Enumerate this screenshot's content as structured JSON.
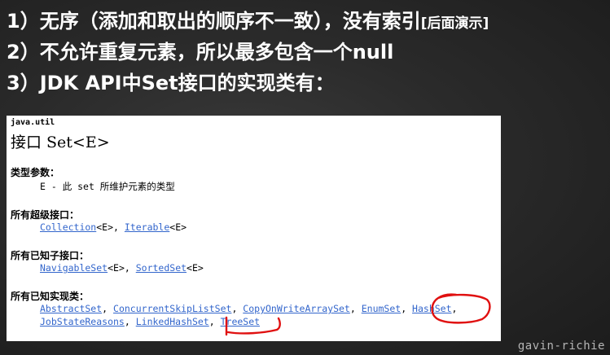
{
  "headings": {
    "l1_main": "1）无序（添加和取出的顺序不一致），没有索引",
    "l1_note": "[后面演示]",
    "l2": "2）不允许重复元素，所以最多包含一个null",
    "l3": "3）JDK API中Set接口的实现类有："
  },
  "doc": {
    "package": "java.util",
    "title": "接口 Set<E>",
    "type_params": {
      "label": "类型参数：",
      "text": "E - 此 set 所维护元素的类型"
    },
    "superinterfaces": {
      "label": "所有超级接口：",
      "links": [
        "Collection",
        "Iterable"
      ],
      "suffix": "<E>"
    },
    "subinterfaces": {
      "label": "所有已知子接口：",
      "links": [
        "NavigableSet",
        "SortedSet"
      ],
      "suffix": "<E>"
    },
    "implementing": {
      "label": "所有已知实现类：",
      "row1": [
        "AbstractSet",
        "ConcurrentSkipListSet",
        "CopyOnWriteArraySet",
        "EnumSet",
        "HashSet"
      ],
      "row2": [
        "JobStateReasons",
        "LinkedHashSet",
        "TreeSet"
      ]
    },
    "separator": ", "
  },
  "colors": {
    "link": "#3366cc",
    "annotation": "#e01010"
  },
  "watermark": "gavin-richie"
}
